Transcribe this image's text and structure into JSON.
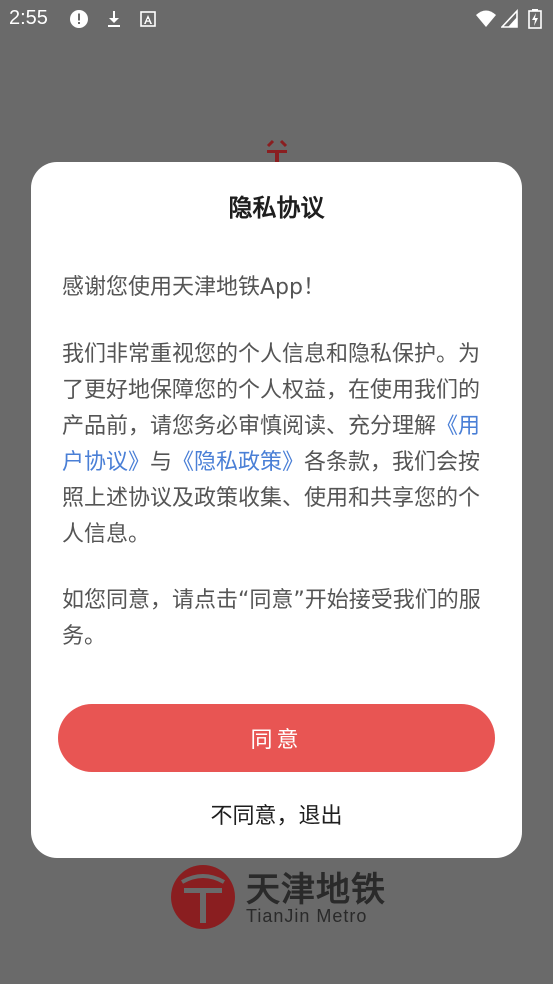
{
  "status_bar": {
    "time": "2:55",
    "icons": [
      "alert-icon",
      "download-icon",
      "font-icon",
      "wifi-icon",
      "signal-icon",
      "battery-icon"
    ]
  },
  "background": {
    "logo_cn": "天津地铁",
    "logo_en": "TianJin Metro",
    "logo_color": "#9e1b1f"
  },
  "dialog": {
    "title": "隐私协议",
    "greeting": "感谢您使用天津地铁App！",
    "para2": {
      "part1": "我们非常重视您的个人信息和隐私保护。为了更好地保障您的个人权益，在使用我们的产品前，请您务必审慎阅读、充分理解",
      "link_user": "《用户协议》",
      "and": "与",
      "link_privacy": "《隐私政策》",
      "part2": "各条款，我们会按照上述协议及政策收集、使用和共享您的个人信息。"
    },
    "para3": "如您同意，请点击“同意”开始接受我们的服务。",
    "agree_label": "同意",
    "disagree_label": "不同意，退出"
  },
  "colors": {
    "accent": "#e85553",
    "link": "#4a7fd6",
    "overlay": "#6a6a6a"
  }
}
